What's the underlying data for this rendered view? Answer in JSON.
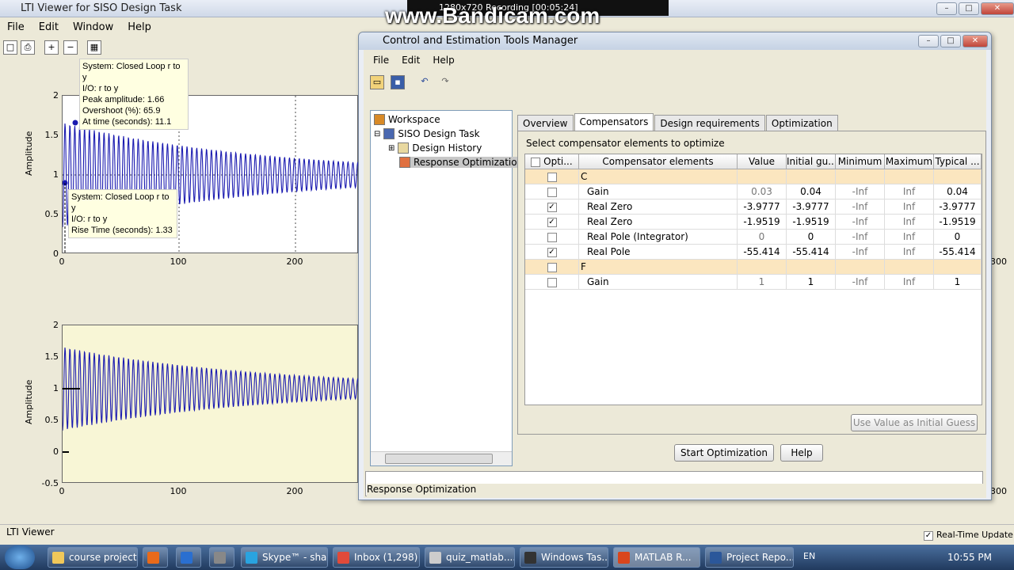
{
  "lti": {
    "title": "LTI Viewer for SISO Design Task",
    "menu": [
      "File",
      "Edit",
      "Window",
      "Help"
    ],
    "tip1": [
      "System: Closed Loop r to y",
      "I/O: r to y",
      "Peak amplitude: 1.66",
      "Overshoot (%): 65.9",
      "At time (seconds): 11.1"
    ],
    "tip2": [
      "System: Closed Loop r to y",
      "I/O: r to y",
      "Rise Time (seconds): 1.33"
    ],
    "ylabel": "Amplitude",
    "yticks1": [
      "2",
      "1.5",
      "1",
      "0.5",
      "0"
    ],
    "yticks2": [
      "2",
      "1.5",
      "1",
      "0.5",
      "0",
      "-0.5"
    ],
    "xticks": [
      "0",
      "100",
      "200"
    ],
    "xtick_right": "300",
    "status": "LTI Viewer",
    "realtime": "Real-Time Update"
  },
  "bandicam": {
    "text": "www.Bandicam.com",
    "bar": "1280x720    Recording [00:05:24]"
  },
  "cetm": {
    "title": "Control and Estimation Tools Manager",
    "menu": [
      "File",
      "Edit",
      "Help"
    ],
    "tree": {
      "workspace": "Workspace",
      "task": "SISO Design Task",
      "history": "Design History",
      "resp": "Response Optimization"
    },
    "tabs": [
      "Overview",
      "Compensators",
      "Design requirements",
      "Optimization"
    ],
    "instruction": "Select compensator elements to optimize",
    "headers": [
      "Opti...",
      "Compensator elements",
      "Value",
      "Initial gu...",
      "Minimum",
      "Maximum",
      "Typical ..."
    ],
    "rows": [
      {
        "group": true,
        "name": "C"
      },
      {
        "checked": false,
        "name": "Gain",
        "value": "0.03",
        "initial": "0.04",
        "min": "-Inf",
        "max": "Inf",
        "typical": "0.04"
      },
      {
        "checked": true,
        "name": "Real Zero",
        "value": "-3.9777",
        "initial": "-3.9777",
        "min": "-Inf",
        "max": "Inf",
        "typical": "-3.9777"
      },
      {
        "checked": true,
        "name": "Real Zero",
        "value": "-1.9519",
        "initial": "-1.9519",
        "min": "-Inf",
        "max": "Inf",
        "typical": "-1.9519"
      },
      {
        "checked": false,
        "name": "Real Pole (Integrator)",
        "value": "0",
        "initial": "0",
        "min": "-Inf",
        "max": "Inf",
        "typical": "0"
      },
      {
        "checked": true,
        "name": "Real Pole",
        "value": "-55.414",
        "initial": "-55.414",
        "min": "-Inf",
        "max": "Inf",
        "typical": "-55.414"
      },
      {
        "group": true,
        "name": "F"
      },
      {
        "checked": false,
        "name": "Gain",
        "value": "1",
        "initial": "1",
        "min": "-Inf",
        "max": "Inf",
        "typical": "1"
      }
    ],
    "use_value_btn": "Use Value as Initial Guess",
    "start_btn": "Start Optimization",
    "help_btn": "Help",
    "status": "Response Optimization"
  },
  "taskbar": {
    "items": [
      "course project",
      "",
      "",
      "",
      "Skype™ - sha...",
      "Inbox (1,298) ...",
      "quiz_matlab....",
      "Windows Tas...",
      "MATLAB R...",
      "Project Repo..."
    ],
    "lang": "EN",
    "time": "10:55 PM"
  }
}
